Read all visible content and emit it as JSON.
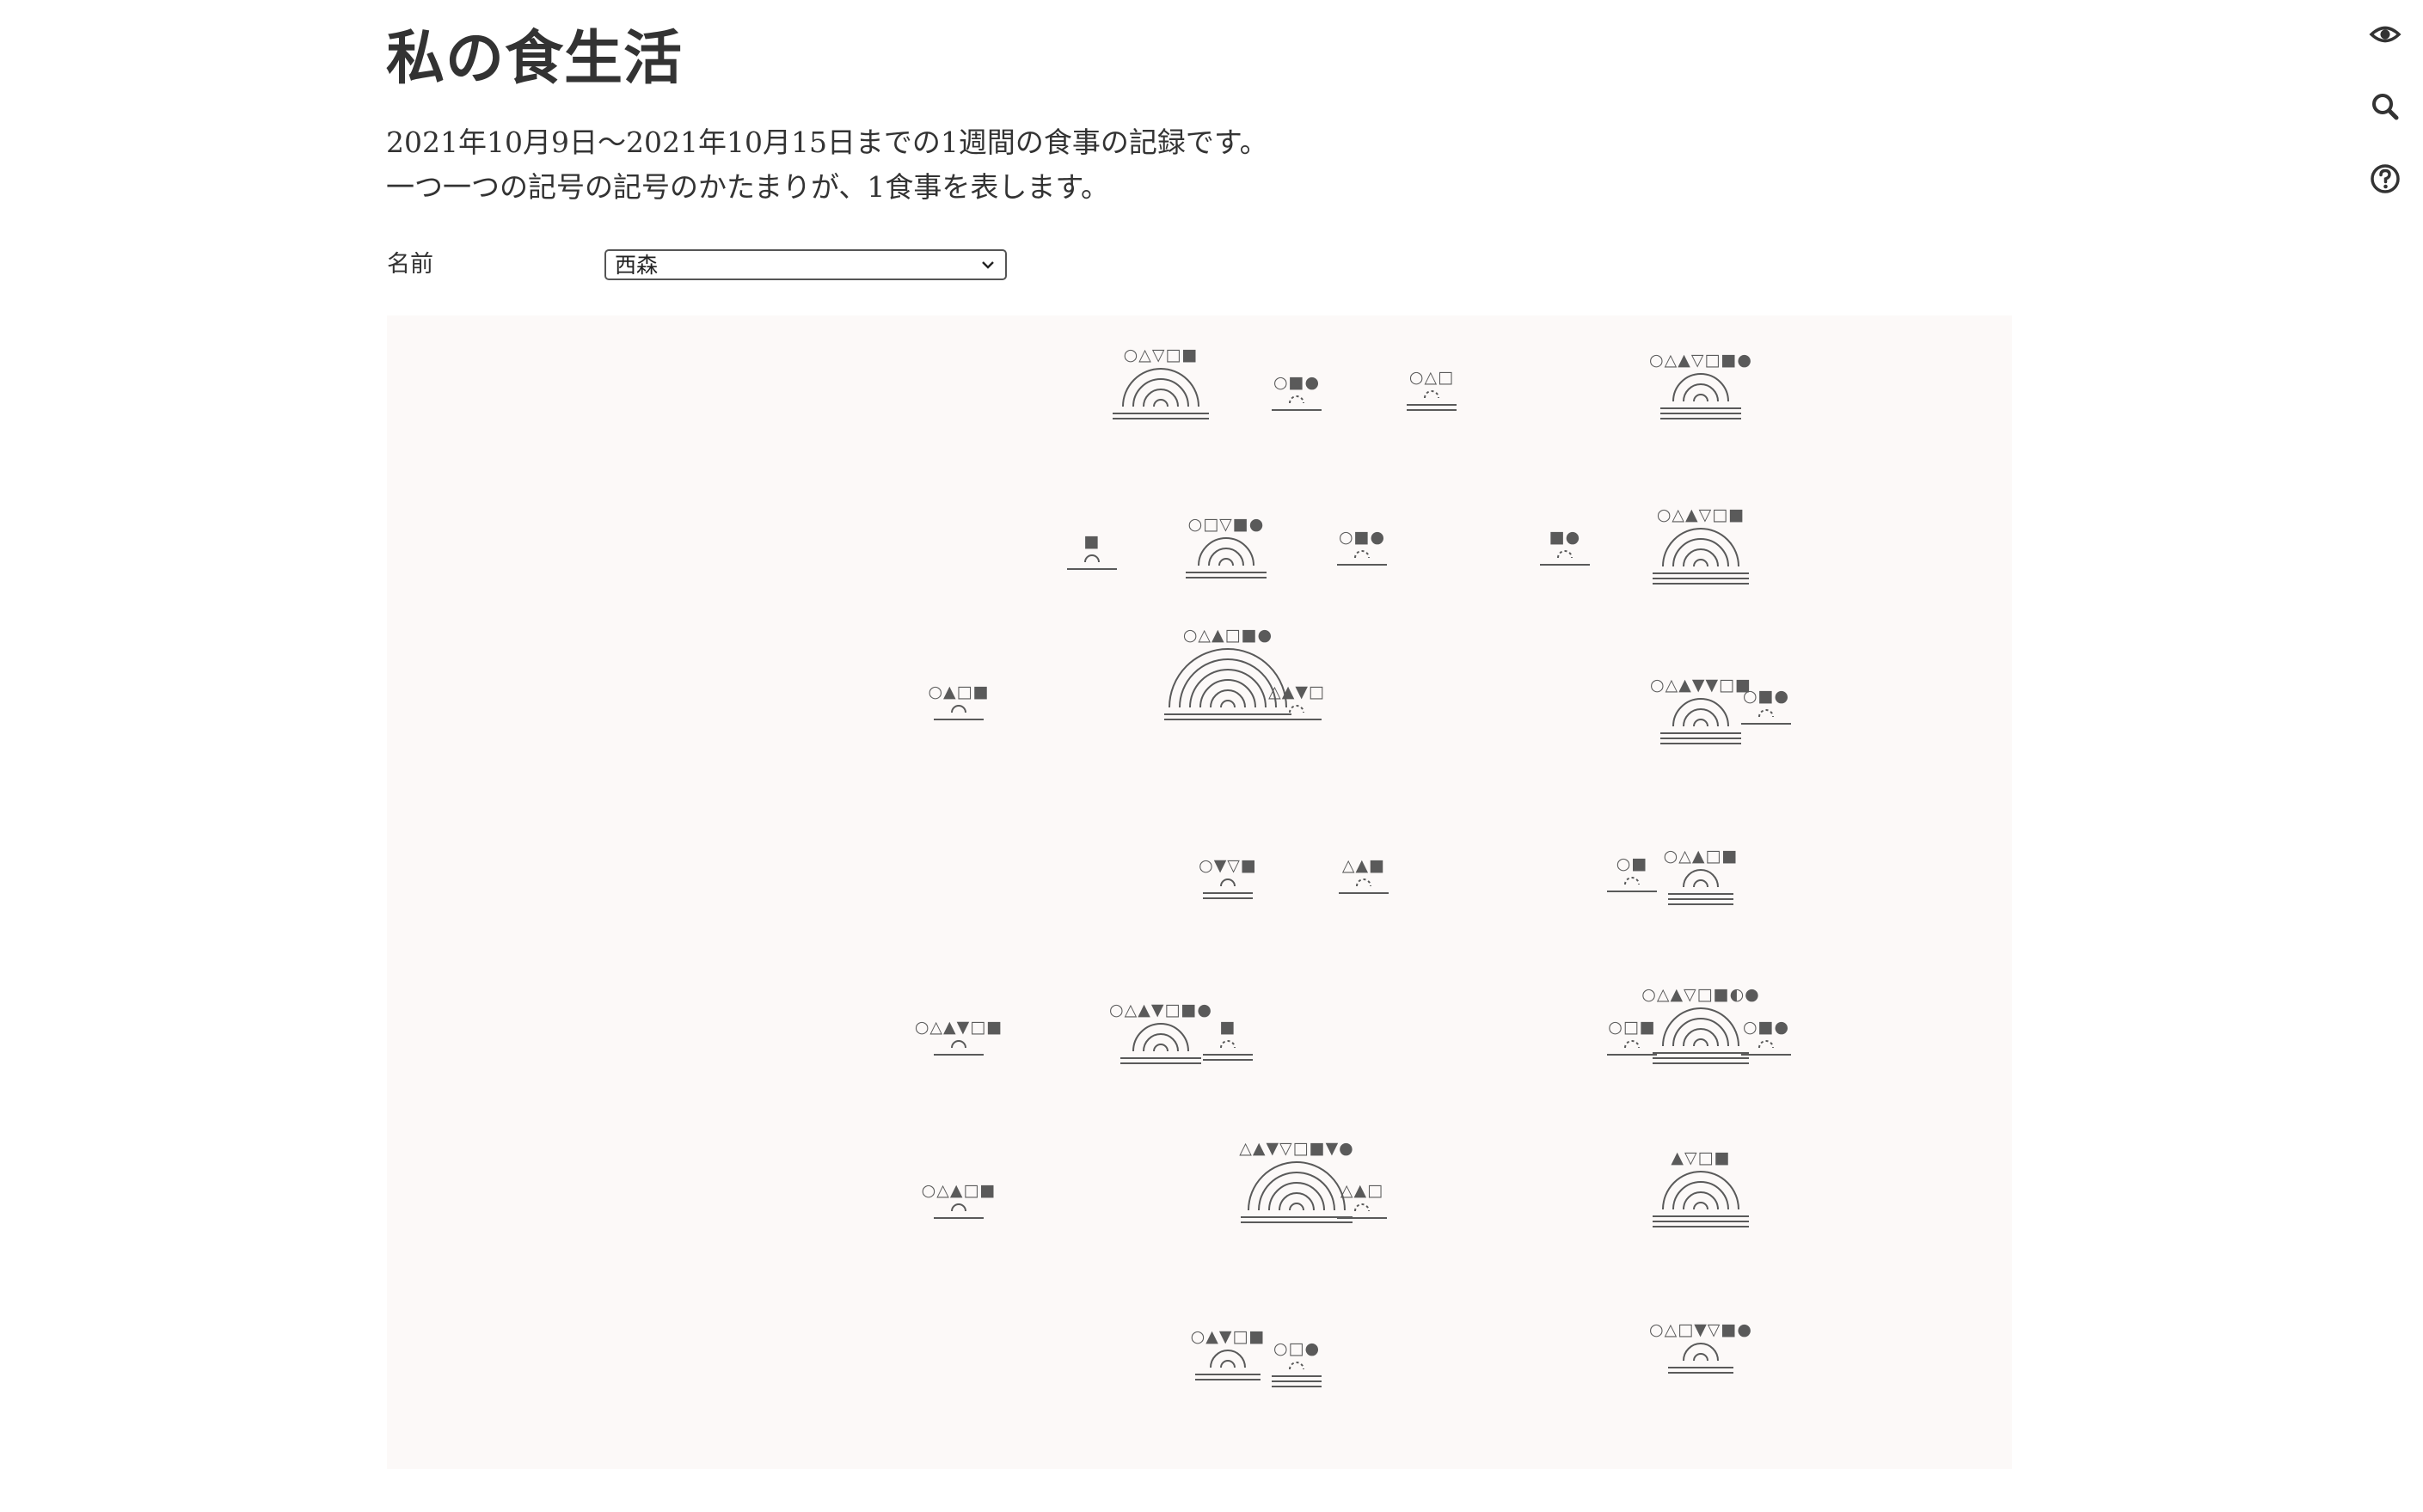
{
  "page": {
    "title": "私の食生活",
    "description_line1": "2021年10月9日〜2021年10月15日までの1週間の食事の記録です。",
    "description_line2": "一つ一つの記号の記号のかたまりが、1食事を表します。"
  },
  "form": {
    "name_label": "名前",
    "name_selected": "西森"
  },
  "toolbar": {
    "icons": [
      "eye-icon",
      "search-icon",
      "help-icon"
    ]
  },
  "colors": {
    "symbol": "#5a5a5a",
    "board_bg": "#fcf9f8",
    "text": "#333333"
  },
  "chart_data": {
    "type": "glyph",
    "description": "",
    "meals": [
      {
        "row": 1,
        "symbols": "○△▽□■",
        "arcs": 4,
        "lines": 2
      },
      {
        "row": 1,
        "symbols": "○■●",
        "arcs": 1,
        "dotted": true,
        "lines": 1
      },
      {
        "row": 1,
        "symbols": "○△□",
        "arcs": 1,
        "dotted": true,
        "lines": 2
      },
      {
        "row": 1,
        "symbols": "○△▲▽□■●",
        "arcs": 3,
        "lines": 3
      },
      {
        "row": 2,
        "symbols": "■",
        "arcs": 1,
        "lines": 1
      },
      {
        "row": 2,
        "symbols": "○□▽■●",
        "arcs": 3,
        "lines": 2
      },
      {
        "row": 2,
        "symbols": "○■●",
        "arcs": 1,
        "dotted": true,
        "lines": 1
      },
      {
        "row": 2,
        "symbols": "■●",
        "arcs": 1,
        "dotted": true,
        "lines": 1
      },
      {
        "row": 2,
        "symbols": "○△▲▽□■",
        "arcs": 4,
        "lines": 3
      },
      {
        "row": 3,
        "symbols": "○▲□■",
        "arcs": 1,
        "lines": 1
      },
      {
        "row": 3,
        "symbols": "○△▲□■●",
        "arcs": 6,
        "lines": 2
      },
      {
        "row": 3,
        "symbols": "△▲▼□",
        "arcs": 1,
        "dotted": true,
        "lines": 1
      },
      {
        "row": 3,
        "symbols": "○△▲▼▼□■",
        "arcs": 3,
        "lines": 3
      },
      {
        "row": 3,
        "symbols": "○■●",
        "arcs": 1,
        "dotted": true,
        "lines": 1
      },
      {
        "row": 4,
        "symbols": "○▼▽■",
        "arcs": 1,
        "lines": 2
      },
      {
        "row": 4,
        "symbols": "△▲■",
        "arcs": 1,
        "dotted": true,
        "lines": 1
      },
      {
        "row": 4,
        "symbols": "○■",
        "arcs": 1,
        "dotted": true,
        "lines": 1
      },
      {
        "row": 4,
        "symbols": "○△▲□■",
        "arcs": 2,
        "lines": 3
      },
      {
        "row": 5,
        "symbols": "○△▲▼□■",
        "arcs": 1,
        "lines": 1
      },
      {
        "row": 5,
        "symbols": "○△▲▼□■●",
        "arcs": 3,
        "lines": 2
      },
      {
        "row": 5,
        "symbols": "■",
        "arcs": 1,
        "dotted": true,
        "lines": 2
      },
      {
        "row": 5,
        "symbols": "○□■",
        "arcs": 1,
        "dotted": true,
        "lines": 1
      },
      {
        "row": 5,
        "symbols": "○△▲▽□■◐●",
        "arcs": 4,
        "lines": 3
      },
      {
        "row": 5,
        "symbols": "○■●",
        "arcs": 1,
        "dotted": true,
        "lines": 1
      },
      {
        "row": 6,
        "symbols": "○△▲□■",
        "arcs": 1,
        "lines": 1
      },
      {
        "row": 6,
        "symbols": "△▲▼▽□■▼●",
        "arcs": 5,
        "lines": 2
      },
      {
        "row": 6,
        "symbols": "△▲□",
        "arcs": 1,
        "dotted": true,
        "lines": 1
      },
      {
        "row": 6,
        "symbols": "▲▽□■",
        "arcs": 4,
        "lines": 3
      },
      {
        "row": 7,
        "symbols": "○▲▼□■",
        "arcs": 2,
        "lines": 2
      },
      {
        "row": 7,
        "symbols": "○□●",
        "arcs": 1,
        "dotted": true,
        "lines": 3
      },
      {
        "row": 7,
        "symbols": "○△□▼▽■●",
        "arcs": 2,
        "lines": 2
      }
    ]
  }
}
